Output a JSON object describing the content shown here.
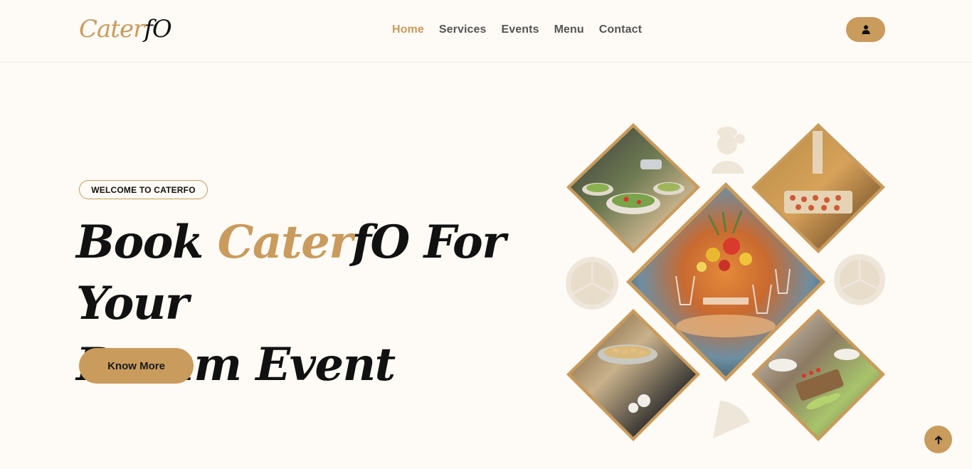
{
  "brand": {
    "logo_part1": "Cater",
    "logo_part2": "fO"
  },
  "nav": {
    "items": [
      {
        "label": "Home",
        "active": true
      },
      {
        "label": "Services",
        "active": false
      },
      {
        "label": "Events",
        "active": false
      },
      {
        "label": "Menu",
        "active": false
      },
      {
        "label": "Contact",
        "active": false
      }
    ]
  },
  "header": {
    "user_icon": "user-icon"
  },
  "hero": {
    "badge": "WELCOME TO CATERFO",
    "title_part1": "Book ",
    "title_brand1": "Cater",
    "title_brand2": "fO",
    "title_part2": " For Your",
    "title_line2": "Dream Event",
    "cta": "Know More"
  },
  "collage": {
    "images": [
      "salad-buffet-photo",
      "canapes-photo",
      "table-centerpiece-photo",
      "chafing-dishes-photo",
      "appetizer-platter-photo"
    ],
    "decorations": [
      "chef-icon",
      "pizza-icon",
      "pizza-icon",
      "pizza-slice-icon"
    ]
  },
  "scroll_top": {
    "icon": "arrow-up-icon"
  },
  "colors": {
    "accent": "#c99b5c",
    "background": "#fefaf5",
    "text": "#111111",
    "nav_text": "#555555"
  }
}
